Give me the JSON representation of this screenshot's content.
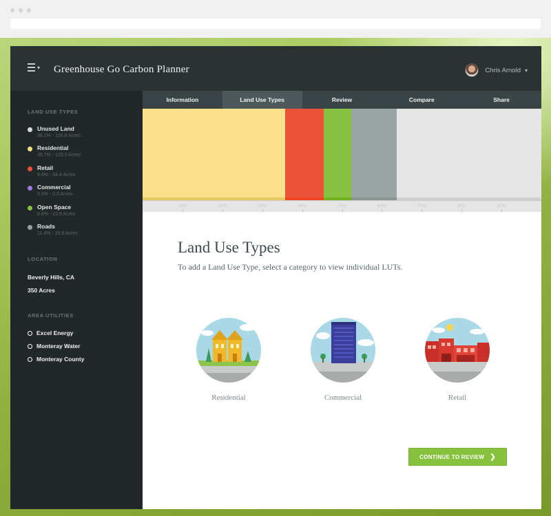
{
  "app": {
    "title": "Greenhouse Go Carbon Planner"
  },
  "user": {
    "name": "Chris Arnold"
  },
  "tabs": [
    {
      "label": "Information"
    },
    {
      "label": "Land Use Types"
    },
    {
      "label": "Review"
    },
    {
      "label": "Compare"
    },
    {
      "label": "Share"
    }
  ],
  "sidebar": {
    "land_use_heading": "LAND USE TYPES",
    "land_use_types": [
      {
        "name": "Unused Land",
        "stat": "36.2% - 126.8 Acres",
        "color": "#d8d8d8"
      },
      {
        "name": "Residential",
        "stat": "35.7% - 125.0 Acres",
        "color": "#f7df7e"
      },
      {
        "name": "Retail",
        "stat": "9.8% - 34.4 Acres",
        "color": "#ea5338"
      },
      {
        "name": "Commercial",
        "stat": "0.0% - 0.0 Acres",
        "color": "#9b7be0"
      },
      {
        "name": "Open Space",
        "stat": "6.8% - 23.9 Acres",
        "color": "#87c140"
      },
      {
        "name": "Roads",
        "stat": "11.4% - 39.9 Acres",
        "color": "#98a2a4"
      }
    ],
    "location_heading": "LOCATION",
    "location": "Beverly Hills, CA",
    "acreage": "350 Acres",
    "utilities_heading": "AREA UTILITIES",
    "utilities": [
      "Excel Energy",
      "Monteray Water",
      "Monteray County"
    ]
  },
  "chart_data": {
    "type": "bar",
    "orientation": "horizontal-stacked",
    "unit": "%",
    "segments": [
      {
        "name": "Residential",
        "value": 35.7,
        "color": "#fae08a"
      },
      {
        "name": "Retail",
        "value": 9.8,
        "color": "#ea5338"
      },
      {
        "name": "Open Space",
        "value": 6.8,
        "color": "#87c140"
      },
      {
        "name": "Roads",
        "value": 11.4,
        "color": "#9ba4a5"
      },
      {
        "name": "Unused Land",
        "value": 36.2,
        "color": "#e4e5e4"
      }
    ],
    "xlim": [
      0,
      100
    ],
    "ticks": [
      "10%",
      "20%",
      "30%",
      "40%",
      "50%",
      "60%",
      "70%",
      "80%",
      "90%"
    ],
    "tick_values": [
      10,
      20,
      30,
      40,
      50,
      60,
      70,
      80,
      90
    ]
  },
  "main": {
    "heading": "Land Use Types",
    "subtitle": "To add a Land Use Type, select a category to view individual LUTs.",
    "categories": [
      {
        "label": "Residential",
        "icon": "residential-icon"
      },
      {
        "label": "Commercial",
        "icon": "commercial-icon"
      },
      {
        "label": "Retail",
        "icon": "retail-icon"
      }
    ],
    "cta_label": "CONTINUE TO REVIEW"
  }
}
